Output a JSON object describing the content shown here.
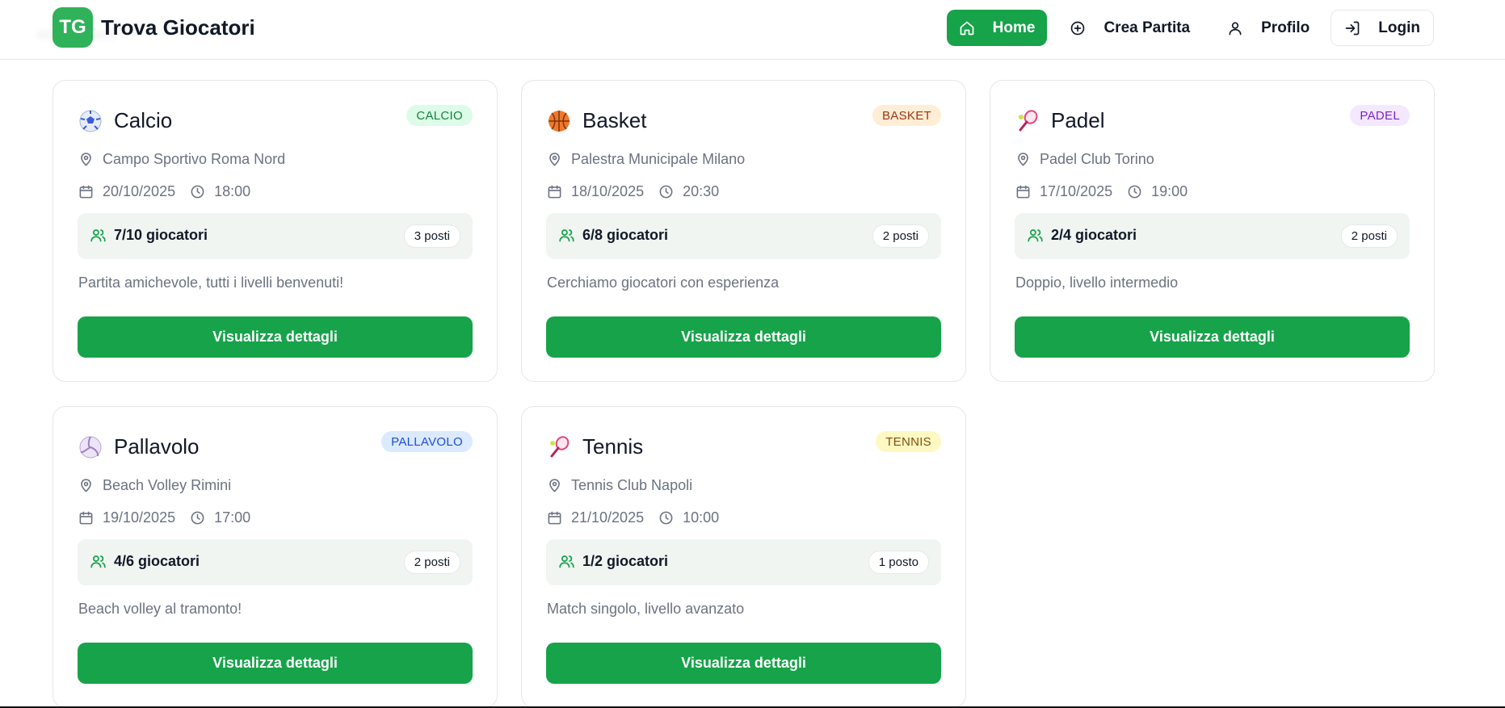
{
  "header": {
    "logo_text": "TG",
    "title": "Trova Giocatori",
    "nav": [
      {
        "label": "Home",
        "icon": "home-icon"
      },
      {
        "label": "Crea Partita",
        "icon": "plus-circle-icon"
      },
      {
        "label": "Profilo",
        "icon": "user-icon"
      },
      {
        "label": "Login",
        "icon": "login-icon"
      }
    ]
  },
  "colors": {
    "primary": "#16a34a",
    "logo": "#2fb25a",
    "muted_text": "#6b7280",
    "players_bg": "#f0f5f1"
  },
  "cards": [
    {
      "sport": "Calcio",
      "icon": "soccer-ball-icon",
      "badge": "CALCIO",
      "badge_bg": "#dcfce7",
      "badge_fg": "#15803d",
      "location": "Campo Sportivo Roma Nord",
      "date": "20/10/2025",
      "time": "18:00",
      "players": "7/10 giocatori",
      "slots": "3 posti",
      "description": "Partita amichevole, tutti i livelli benvenuti!",
      "button": "Visualizza dettagli"
    },
    {
      "sport": "Basket",
      "icon": "basketball-icon",
      "badge": "BASKET",
      "badge_bg": "#ffedd5",
      "badge_fg": "#9a3412",
      "location": "Palestra Municipale Milano",
      "date": "18/10/2025",
      "time": "20:30",
      "players": "6/8 giocatori",
      "slots": "2 posti",
      "description": "Cerchiamo giocatori con esperienza",
      "button": "Visualizza dettagli"
    },
    {
      "sport": "Padel",
      "icon": "racket-icon",
      "badge": "PADEL",
      "badge_bg": "#f3e8ff",
      "badge_fg": "#7e22ce",
      "location": "Padel Club Torino",
      "date": "17/10/2025",
      "time": "19:00",
      "players": "2/4 giocatori",
      "slots": "2 posti",
      "description": "Doppio, livello intermedio",
      "button": "Visualizza dettagli"
    },
    {
      "sport": "Pallavolo",
      "icon": "volleyball-icon",
      "badge": "PALLAVOLO",
      "badge_bg": "#dbeafe",
      "badge_fg": "#1d4ed8",
      "location": "Beach Volley Rimini",
      "date": "19/10/2025",
      "time": "17:00",
      "players": "4/6 giocatori",
      "slots": "2 posti",
      "description": "Beach volley al tramonto!",
      "button": "Visualizza dettagli"
    },
    {
      "sport": "Tennis",
      "icon": "racket-icon",
      "badge": "TENNIS",
      "badge_bg": "#fef9c3",
      "badge_fg": "#854d0e",
      "location": "Tennis Club Napoli",
      "date": "21/10/2025",
      "time": "10:00",
      "players": "1/2 giocatori",
      "slots": "1 posto",
      "description": "Match singolo, livello avanzato",
      "button": "Visualizza dettagli"
    }
  ]
}
